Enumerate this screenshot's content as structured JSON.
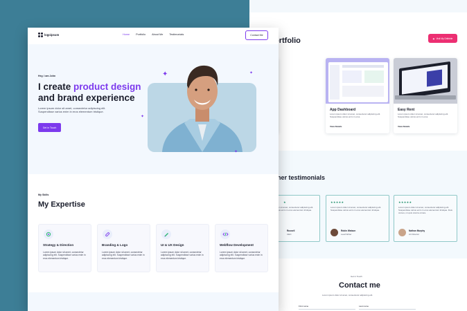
{
  "front": {
    "logo_text": "logoipsum",
    "nav": [
      "Home",
      "Portfolio",
      "About Me",
      "Testimonials"
    ],
    "contact_button": "Contact Me",
    "hero": {
      "pre": "Hey, I am John",
      "headline_1": "I create ",
      "headline_accent": "product design",
      "headline_2": "and brand experience",
      "description": "Lorem ipsum dolor sit amet, consectetur adipiscing elit. Suspendisse varius enim in eros elementum tristique.",
      "cta": "Get in Touch"
    },
    "expertise": {
      "pre": "My Skills",
      "title": "My Expertise",
      "cards": [
        {
          "title": "Strategy & Direction",
          "desc": "Lorem ipsum dolor sit amet, consectetur adipiscing elit. Suspendisse varius enim in eros elementum tristique.",
          "icon": "strategy-icon"
        },
        {
          "title": "Branding & Logo",
          "desc": "Lorem ipsum dolor sit amet, consectetur adipiscing elit. Suspendisse varius enim in eros elementum tristique.",
          "icon": "link-icon"
        },
        {
          "title": "UI & UX Design",
          "desc": "Lorem ipsum dolor sit amet, consectetur adipiscing elit. Suspendisse varius enim in eros elementum tristique.",
          "icon": "pen-icon"
        },
        {
          "title": "Webflow Development",
          "desc": "Lorem ipsum dolor sit amet, consectetur adipiscing elit. Suspendisse varius enim in eros elementum tristique.",
          "icon": "code-icon"
        }
      ]
    }
  },
  "back": {
    "portfolio_title": "ortfolio",
    "portfolio_button": "Visit My Dribbble",
    "projects": [
      {
        "title": "",
        "desc": "Lorem ipsum dolor sit amet, consectetur adipiscing elit. Suspendisse varius enim in eros.",
        "link": "View Details"
      },
      {
        "title": "App Dashboard",
        "desc": "Lorem ipsum dolor sit amet, consectetur adipiscing elit. Suspendisse varius enim in eros.",
        "link": "View Details"
      },
      {
        "title": "Easy Rent",
        "desc": "Lorem ipsum dolor sit amet, consectetur adipiscing elit. Suspendisse varius enim in eros.",
        "link": "View Details"
      }
    ],
    "testimonials_title": "ner testimonials",
    "testimonials": [
      {
        "stars": "★",
        "text": "Lorem ipsum dolor sit amet, consectetur adipiscing elit. Suspendisse varius enim in eros elementum tristique.",
        "name": "Russell",
        "role": "CEO"
      },
      {
        "stars": "★★★★★",
        "text": "Lorem ipsum dolor sit amet, consectetur adipiscing elit. Suspendisse varius enim in eros elementum tristique.",
        "name": "Robin Watson",
        "role": "Lead Writer"
      },
      {
        "stars": "★★★★★",
        "text": "Lorem ipsum dolor sit amet, consectetur adipiscing elit. Suspendisse varius enim in eros elementum tristique. Duis cursus, mi quis viverra ornare.",
        "name": "Nathan Murphy",
        "role": "Art Director"
      }
    ],
    "contact": {
      "pre": "Get in Touch",
      "title": "Contact me",
      "desc": "Lorem ipsum dolor sit amet, consectetur adipiscing elit.",
      "first_name_label": "First name",
      "last_name_label": "Last name"
    }
  },
  "colors": {
    "accent": "#7c3aed",
    "pink": "#ec2f72",
    "teal_bg": "#3d7e96",
    "star": "#1e8e6a"
  }
}
